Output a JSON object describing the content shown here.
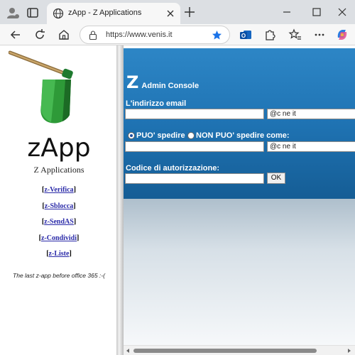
{
  "browser": {
    "tab_title": "zApp - Z Applications",
    "url": "https://www.venis.it",
    "accent": "#1a73e8"
  },
  "sidebar": {
    "brand": "zApp",
    "subtitle": "Z Applications",
    "links": [
      {
        "pre": "[",
        "label": "z-Verifica",
        "post": "]"
      },
      {
        "pre": "[",
        "label": "z-Sblocca",
        "post": "]"
      },
      {
        "pre": "[",
        "label": "z-SendAS",
        "post": "]"
      },
      {
        "pre": "[",
        "label": "z-Condividi",
        "post": "]"
      },
      {
        "pre": "[",
        "label": "z-Liste",
        "post": "]"
      }
    ],
    "tagline": "The last z-app before office 365 :-("
  },
  "console": {
    "logo_letter": "Z",
    "title": "Admin Console",
    "email_label": "L'indirizzo email",
    "email_value": "",
    "email_domain": "@c          ne     it",
    "radio_can": "PUO' spedire",
    "radio_cannot": "NON PUO' spedire come:",
    "sendas_value": "",
    "sendas_domain": "@c          ne     it",
    "auth_label": "Codice di autorizzazione:",
    "auth_value": "",
    "ok_label": "OK",
    "panel_color": "#1f73b3"
  }
}
